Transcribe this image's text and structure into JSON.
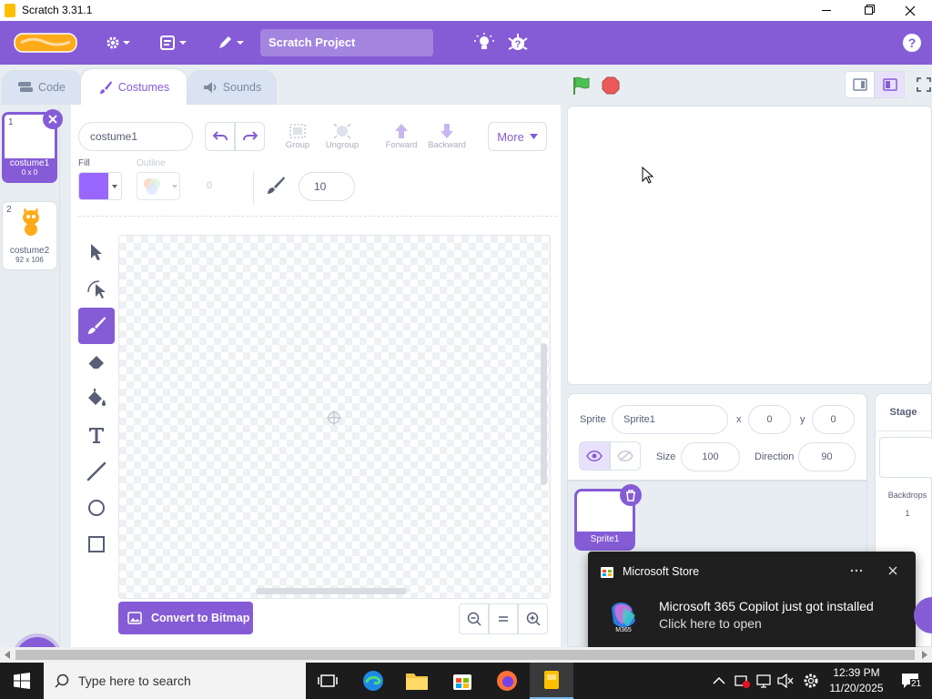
{
  "window": {
    "title": "Scratch 3.31.1"
  },
  "menubar": {
    "project_title": "Scratch Project"
  },
  "tabs": {
    "code": "Code",
    "costumes": "Costumes",
    "sounds": "Sounds"
  },
  "costumes": [
    {
      "num": "1",
      "name": "costume1",
      "size": "0 x 0"
    },
    {
      "num": "2",
      "name": "costume2",
      "size": "92 x 106"
    }
  ],
  "paint": {
    "costume_name": "costume1",
    "group": "Group",
    "ungroup": "Ungroup",
    "forward": "Forward",
    "backward": "Backward",
    "more": "More",
    "fill_label": "Fill",
    "outline_label": "Outline",
    "outline_value": "0",
    "brush_size": "10",
    "convert_button": "Convert to Bitmap",
    "fill_color": "#9966ff"
  },
  "sprite_info": {
    "sprite_label": "Sprite",
    "sprite_name": "Sprite1",
    "x_label": "x",
    "x_value": "0",
    "y_label": "y",
    "y_value": "0",
    "size_label": "Size",
    "size_value": "100",
    "direction_label": "Direction",
    "direction_value": "90"
  },
  "sprites": [
    {
      "name": "Sprite1"
    }
  ],
  "stage_pane": {
    "title": "Stage",
    "backdrops_label": "Backdrops",
    "backdrops_count": "1"
  },
  "toast": {
    "app": "Microsoft Store",
    "message": "Microsoft 365 Copilot just got installed",
    "action": "Click here to open",
    "logo_text": "M365"
  },
  "taskbar": {
    "search_placeholder": "Type here to search",
    "time": "12:39 PM",
    "date": "11/20/2025",
    "notif_count": "21"
  },
  "colors": {
    "accent": "#855cd6",
    "toast_bg": "#1f1f1f"
  }
}
